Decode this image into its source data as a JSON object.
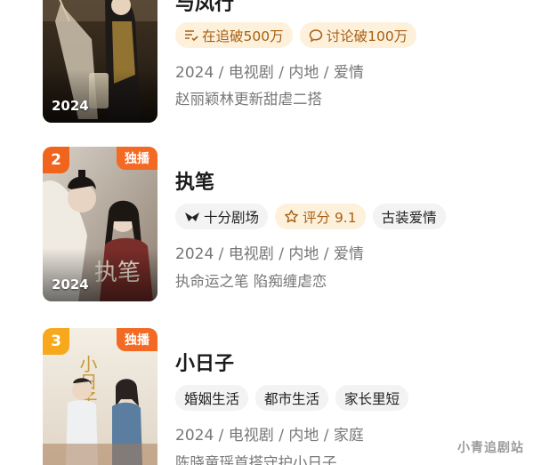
{
  "items": [
    {
      "title": "与凤行",
      "year_badge": "2024",
      "rank": "",
      "exclusive": "",
      "tags": [
        {
          "icon": "tracking-list-icon",
          "label": "在追破500万"
        },
        {
          "icon": "comment-bubble-icon",
          "label": "讨论破100万"
        }
      ],
      "meta": "2024 / 电视剧 / 内地 / 爱情",
      "description": "赵丽颖林更新甜虐二搭"
    },
    {
      "title": "执笔",
      "year_badge": "2024",
      "rank": "2",
      "exclusive": "独播",
      "tags": [
        {
          "icon": "theater-logo-icon",
          "label": "十分剧场"
        },
        {
          "icon": "star-outline-icon",
          "label": "评分 9.1"
        },
        {
          "icon": "",
          "label": "古装爱情"
        }
      ],
      "poster_text": "执笔",
      "meta": "2024 / 电视剧 / 内地 / 爱情",
      "description": "执命运之笔 陷痴缠虐恋"
    },
    {
      "title": "小日子",
      "year_badge": "",
      "rank": "3",
      "exclusive": "独播",
      "tags": [
        {
          "icon": "",
          "label": "婚姻生活"
        },
        {
          "icon": "",
          "label": "都市生活"
        },
        {
          "icon": "",
          "label": "家长里短"
        }
      ],
      "poster_text": "小日子",
      "meta": "2024 / 电视剧 / 内地 / 家庭",
      "description": "陈晓童瑶首搭守护小日子"
    }
  ],
  "watermark": "小青追剧站",
  "colors": {
    "rank2": "#f0641e",
    "rank3": "#f7a81b",
    "exclusive": "#f26a24",
    "hot_tag_bg": "#fdf1dc",
    "hot_tag_text": "#a85f12",
    "plain_tag_bg": "#f3f3f3"
  }
}
